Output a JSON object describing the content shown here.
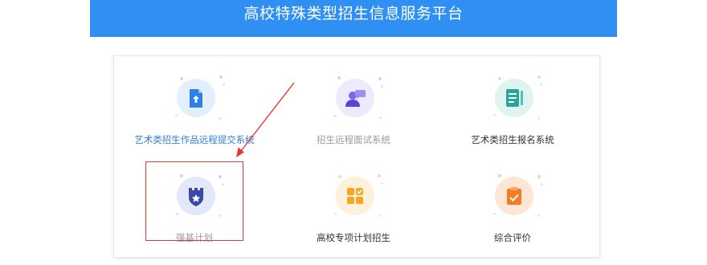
{
  "banner": {
    "title": "高校特殊类型招生信息服务平台"
  },
  "tiles": [
    {
      "label": "艺术类招生作品远程提交系统",
      "icon": "document-upload-icon",
      "label_color": "#2f7fd8",
      "icon_color": "#3b82f6"
    },
    {
      "label": "招生远程面试系统",
      "icon": "interview-person-icon",
      "label_color": "#9a9a9a",
      "icon_color": "#6c5ce7"
    },
    {
      "label": "艺术类招生报名系统",
      "icon": "form-notebook-icon",
      "label_color": "#333333",
      "icon_color": "#26a69a"
    },
    {
      "label": "强基计划",
      "icon": "star-shield-icon",
      "label_color": "#9a9a9a",
      "icon_color": "#3f51b5"
    },
    {
      "label": "高校专项计划招生",
      "icon": "apps-grid-icon",
      "label_color": "#333333",
      "icon_color": "#f5a623"
    },
    {
      "label": "综合评价",
      "icon": "clipboard-check-icon",
      "label_color": "#333333",
      "icon_color": "#f57c22"
    }
  ],
  "colors": {
    "banner_bg": "#2f8ff2",
    "annotation_red": "#e53935"
  }
}
